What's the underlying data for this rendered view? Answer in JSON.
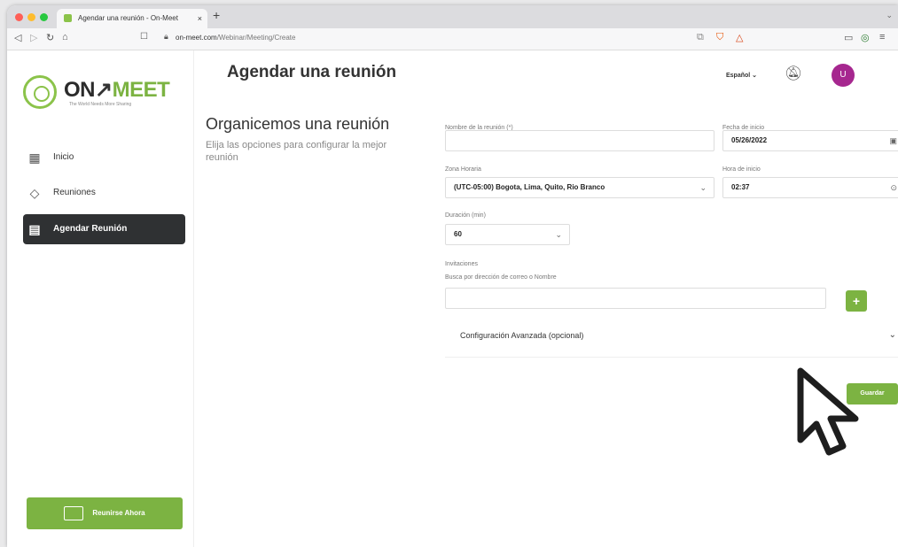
{
  "browser": {
    "tab_title": "Agendar una reunión - On-Meet",
    "tab_close": "×",
    "new_tab": "+",
    "url_domain": "on-meet.com",
    "url_path": "/Webinar/Meeting/Create"
  },
  "brand": {
    "on": "ON",
    "meet": "MEET",
    "tagline": "The World Needs More Sharing"
  },
  "sidebar": {
    "items": [
      {
        "label": "Inicio",
        "icon": "home-icon"
      },
      {
        "label": "Reuniones",
        "icon": "meetings-icon"
      },
      {
        "label": "Agendar Reunión",
        "icon": "calendar-icon"
      }
    ],
    "join_button": "Reunirse Ahora"
  },
  "header": {
    "title": "Agendar una reunión",
    "language": "Español ⌄",
    "avatar_initial": "U"
  },
  "intro": {
    "heading": "Organicemos una reunión",
    "subtext": "Elija las opciones para configurar la mejor reunión"
  },
  "form": {
    "meeting_name_label": "Nombre de la reunión (*)",
    "meeting_name_value": "",
    "start_date_label": "Fecha de inicio",
    "start_date_value": "05/26/2022",
    "timezone_label": "Zona Horaria",
    "timezone_value": "(UTC-05:00) Bogota, Lima, Quito, Rio Branco",
    "start_time_label": "Hora de inicio",
    "start_time_value": "02:37",
    "duration_label": "Duración (min)",
    "duration_value": "60",
    "invitations_label": "Invitaciones",
    "invitations_search_label": "Busca por dirección de correo o Nombre",
    "invitations_value": "",
    "add_symbol": "+",
    "advanced_label": "Configuración Avanzada (opcional)",
    "save_button": "Guardar"
  },
  "colors": {
    "accent": "#7cb342",
    "sidebar_active": "#2f3133",
    "avatar": "#a6278f"
  }
}
